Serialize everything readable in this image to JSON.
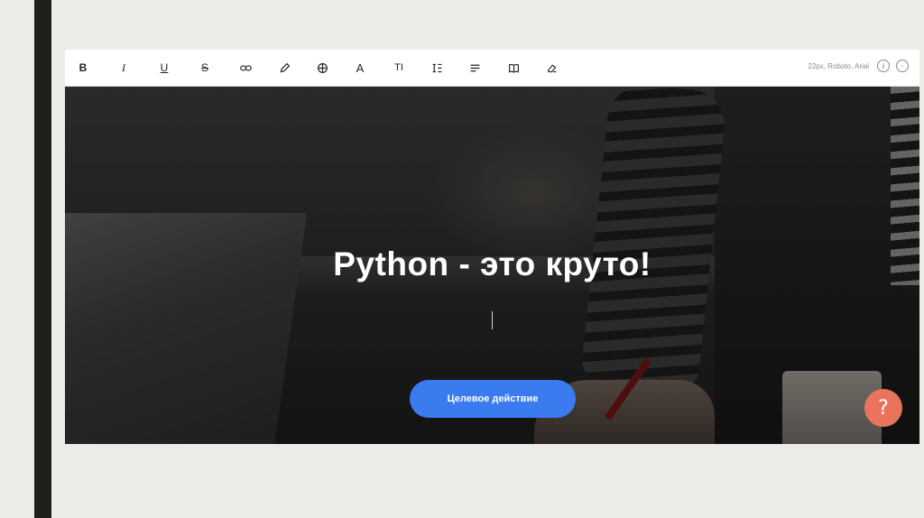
{
  "toolbar": {
    "buttons": [
      {
        "name": "bold-button",
        "glyph": "B",
        "icon": "bold-icon"
      },
      {
        "name": "italic-button",
        "glyph": "I",
        "icon": "italic-icon"
      },
      {
        "name": "underline-button",
        "glyph": "U",
        "icon": "underline-icon"
      },
      {
        "name": "strikethrough-button",
        "glyph": "S",
        "icon": "strikethrough-icon"
      },
      {
        "name": "link-button",
        "glyph": "",
        "icon": "link-icon"
      },
      {
        "name": "color-button",
        "glyph": "",
        "icon": "pencil-icon"
      },
      {
        "name": "globe-button",
        "glyph": "",
        "icon": "globe-icon"
      },
      {
        "name": "font-button",
        "glyph": "A",
        "icon": "font-icon"
      },
      {
        "name": "font-size-button",
        "glyph": "TI",
        "icon": "text-size-icon"
      },
      {
        "name": "line-height-button",
        "glyph": "",
        "icon": "line-height-icon"
      },
      {
        "name": "align-button",
        "glyph": "",
        "icon": "align-left-icon"
      },
      {
        "name": "book-button",
        "glyph": "",
        "icon": "book-icon"
      },
      {
        "name": "clear-format-button",
        "glyph": "",
        "icon": "eraser-icon"
      }
    ],
    "font_info": "22px, Roboto, Arial",
    "info_label": "i",
    "more_label": "·"
  },
  "hero": {
    "title": "Python - это круто!",
    "cta_label": "Целевое действие"
  },
  "help": {
    "label": "?"
  },
  "colors": {
    "accent": "#3a7bf0",
    "help": "#e9735c",
    "sidebar": "#1f1f1b",
    "background": "#ecebe5"
  }
}
